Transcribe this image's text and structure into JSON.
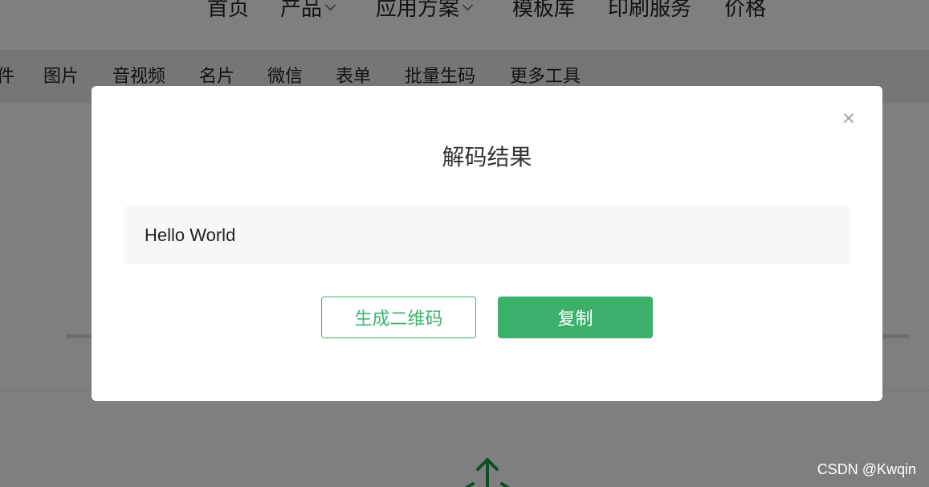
{
  "top_nav": {
    "items": [
      {
        "label": "首页",
        "has_dropdown": false
      },
      {
        "label": "产品",
        "has_dropdown": true
      },
      {
        "label": "应用方案",
        "has_dropdown": true
      },
      {
        "label": "模板库",
        "has_dropdown": false
      },
      {
        "label": "印刷服务",
        "has_dropdown": false
      },
      {
        "label": "价格",
        "has_dropdown": false
      }
    ]
  },
  "tool_tabs": {
    "items": [
      "件",
      "图片",
      "音视频",
      "名片",
      "微信",
      "表单",
      "批量生码",
      "更多工具"
    ]
  },
  "modal": {
    "title": "解码结果",
    "result_text": "Hello World",
    "generate_button": "生成二维码",
    "copy_button": "复制",
    "close_icon": "close-icon"
  },
  "watermark": "CSDN @Kwqin",
  "colors": {
    "accent": "#3bb06a",
    "overlay": "rgba(0,0,0,0.5)",
    "result_bg": "#f6f7f6"
  },
  "icons": {
    "upload": "upload-arrow-icon",
    "chevron": "chevron-down-icon"
  }
}
